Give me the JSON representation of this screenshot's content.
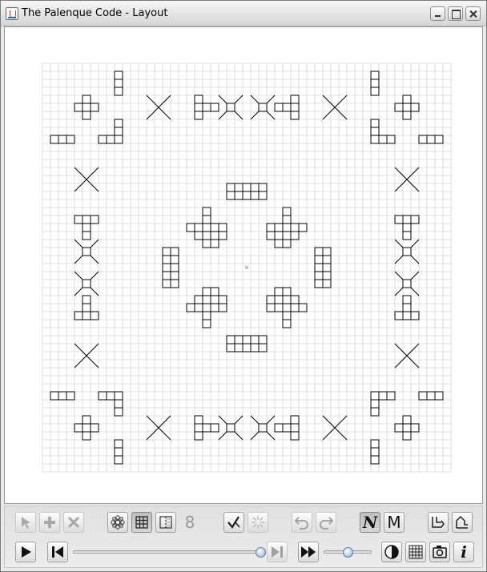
{
  "window": {
    "title": "The Palenque Code - Layout",
    "controls": [
      "minimize-icon",
      "maximize-icon",
      "close-icon"
    ]
  },
  "canvas": {
    "grid_columns": 51,
    "grid_rows": 51,
    "background": "#ffffff",
    "grid_color": "#c8c8c8",
    "shape_color": "#000000"
  },
  "toolbar": {
    "row1": [
      {
        "name": "select-tool",
        "icon": "arrow-pointer-icon",
        "state": "disabled"
      },
      {
        "name": "add-tool",
        "icon": "plus-icon",
        "state": "disabled"
      },
      {
        "name": "delete-tool",
        "icon": "x-icon",
        "state": "disabled"
      },
      {
        "name": "symmetry-tool",
        "icon": "gear-flower-icon",
        "state": "enabled"
      },
      {
        "name": "grid-tool",
        "icon": "grid-icon",
        "state": "active"
      },
      {
        "name": "frame-tool",
        "icon": "dotted-panel-icon",
        "state": "enabled"
      },
      {
        "name": "count-display",
        "icon": "digit-icon",
        "state": "disabled"
      },
      {
        "name": "check-tool",
        "icon": "checkmark-icon",
        "state": "enabled"
      },
      {
        "name": "sparkle-tool",
        "icon": "sparkle-icon",
        "state": "disabled"
      },
      {
        "name": "undo-button",
        "icon": "undo-icon",
        "state": "disabled"
      },
      {
        "name": "redo-button",
        "icon": "redo-icon",
        "state": "disabled"
      },
      {
        "name": "mode-n-button",
        "icon": "letter-n-icon",
        "state": "active"
      },
      {
        "name": "mode-m-button",
        "icon": "letter-m-icon",
        "state": "enabled"
      },
      {
        "name": "path-out-button",
        "icon": "path-out-icon",
        "state": "enabled"
      },
      {
        "name": "path-up-button",
        "icon": "path-up-icon",
        "state": "enabled"
      }
    ],
    "row2": [
      {
        "name": "play-button",
        "icon": "play-icon"
      },
      {
        "name": "skip-to-start-button",
        "icon": "skip-start-icon"
      },
      {
        "name": "timeline-slider",
        "icon": "slider-icon",
        "value": 1.0
      },
      {
        "name": "skip-to-end-button",
        "icon": "skip-end-icon"
      },
      {
        "name": "fast-forward-button",
        "icon": "fast-forward-icon"
      },
      {
        "name": "speed-slider",
        "icon": "slider-icon",
        "value": 0.5
      },
      {
        "name": "contrast-button",
        "icon": "contrast-icon"
      },
      {
        "name": "table-button",
        "icon": "table-icon"
      },
      {
        "name": "snapshot-button",
        "icon": "camera-icon"
      },
      {
        "name": "info-button",
        "icon": "info-icon"
      }
    ],
    "count_label": "8",
    "mode_n_label": "N",
    "mode_m_label": "M",
    "info_label": "i"
  }
}
